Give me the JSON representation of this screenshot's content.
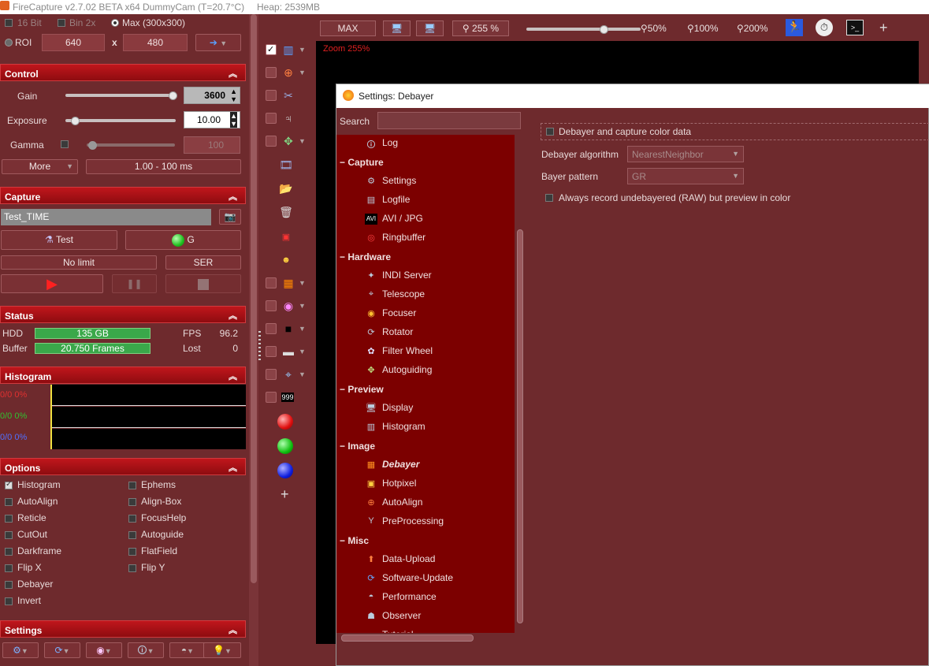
{
  "titlebar": {
    "app": "FireCapture v2.7.02 BETA x64",
    "camera": "DummyCam (T=20.7°C)",
    "heap": "Heap: 2539MB"
  },
  "top_options": {
    "bit16": "16 Bit",
    "bin2x": "Bin 2x",
    "max": "Max (300x300)",
    "roi": "ROI",
    "roi_w": "640",
    "x": "x",
    "roi_h": "480"
  },
  "control": {
    "title": "Control",
    "gain_label": "Gain",
    "gain_value": "3600",
    "gain_level": 0.98,
    "exposure_label": "Exposure",
    "exposure_value": "10.00",
    "exposure_level": 0.05,
    "gamma_label": "Gamma",
    "gamma_value": "100",
    "gamma_level": 0.0,
    "more_label": "More",
    "range_label": "1.00 - 100 ms"
  },
  "capture": {
    "title": "Capture",
    "filename": "Test_TIME",
    "test_label": "Test",
    "g_label": "G",
    "limit_label": "No limit",
    "format_label": "SER"
  },
  "status": {
    "title": "Status",
    "hdd_label": "HDD",
    "hdd_value": "135 GB",
    "fps_label": "FPS",
    "fps_value": "96.2",
    "buffer_label": "Buffer",
    "buffer_value": "20.750 Frames",
    "lost_label": "Lost",
    "lost_value": "0"
  },
  "histogram": {
    "title": "Histogram",
    "rows": [
      {
        "text": "0/0 0%",
        "color": "#e03030"
      },
      {
        "text": "0/0 0%",
        "color": "#30c030"
      },
      {
        "text": "0/0 0%",
        "color": "#5070ff"
      }
    ]
  },
  "options": {
    "title": "Options",
    "left": [
      {
        "label": "Histogram",
        "checked": true
      },
      {
        "label": "AutoAlign",
        "checked": false
      },
      {
        "label": "Reticle",
        "checked": false
      },
      {
        "label": "CutOut",
        "checked": false
      },
      {
        "label": "Darkframe",
        "checked": false
      },
      {
        "label": "Flip X",
        "checked": false
      },
      {
        "label": "Debayer",
        "checked": false
      },
      {
        "label": "Invert",
        "checked": false
      }
    ],
    "right": [
      {
        "label": "Ephems",
        "checked": false
      },
      {
        "label": "Align-Box",
        "checked": false
      },
      {
        "label": "FocusHelp",
        "checked": false
      },
      {
        "label": "Autoguide",
        "checked": false
      },
      {
        "label": "FlatField",
        "checked": false
      },
      {
        "label": "Flip Y",
        "checked": false
      }
    ]
  },
  "settings_section": {
    "title": "Settings"
  },
  "toolbar": {
    "max_label": "MAX",
    "zoom_value": "255 %",
    "z50": "50%",
    "z100": "100%",
    "z200": "200%",
    "plus": "+"
  },
  "preview": {
    "zoom_text": "Zoom 255%"
  },
  "icon_column": {
    "plus": "+"
  },
  "dialog": {
    "title": "Settings: Debayer",
    "search_label": "Search",
    "tree": [
      {
        "type": "item",
        "label": "Log",
        "icon": "info-icon"
      },
      {
        "type": "cat",
        "label": "Capture"
      },
      {
        "type": "item",
        "label": "Settings",
        "icon": "settings-icon"
      },
      {
        "type": "item",
        "label": "Logfile",
        "icon": "logfile-icon"
      },
      {
        "type": "item",
        "label": "AVI / JPG",
        "icon": "avi-icon"
      },
      {
        "type": "item",
        "label": "Ringbuffer",
        "icon": "ringbuffer-icon"
      },
      {
        "type": "cat",
        "label": "Hardware"
      },
      {
        "type": "item",
        "label": "INDI Server",
        "icon": "indi-icon"
      },
      {
        "type": "item",
        "label": "Telescope",
        "icon": "telescope-icon"
      },
      {
        "type": "item",
        "label": "Focuser",
        "icon": "focuser-icon"
      },
      {
        "type": "item",
        "label": "Rotator",
        "icon": "rotator-icon"
      },
      {
        "type": "item",
        "label": "Filter Wheel",
        "icon": "filterwheel-icon"
      },
      {
        "type": "item",
        "label": "Autoguiding",
        "icon": "autoguiding-icon"
      },
      {
        "type": "cat",
        "label": "Preview"
      },
      {
        "type": "item",
        "label": "Display",
        "icon": "display-icon"
      },
      {
        "type": "item",
        "label": "Histogram",
        "icon": "histogram-icon"
      },
      {
        "type": "cat",
        "label": "Image"
      },
      {
        "type": "item",
        "label": "Debayer",
        "icon": "debayer-icon",
        "selected": true
      },
      {
        "type": "item",
        "label": "Hotpixel",
        "icon": "hotpixel-icon"
      },
      {
        "type": "item",
        "label": "AutoAlign",
        "icon": "autoalign-icon"
      },
      {
        "type": "item",
        "label": "PreProcessing",
        "icon": "preprocessing-icon"
      },
      {
        "type": "cat",
        "label": "Misc"
      },
      {
        "type": "item",
        "label": "Data-Upload",
        "icon": "upload-icon"
      },
      {
        "type": "item",
        "label": "Software-Update",
        "icon": "update-icon"
      },
      {
        "type": "item",
        "label": "Performance",
        "icon": "performance-icon"
      },
      {
        "type": "item",
        "label": "Observer",
        "icon": "observer-icon"
      },
      {
        "type": "item",
        "label": "Tutorial",
        "icon": "tutorial-icon"
      }
    ],
    "debayer_check": "Debayer and capture color data",
    "algorithm_label": "Debayer algorithm",
    "algorithm_value": "NearestNeighbor",
    "pattern_label": "Bayer pattern",
    "pattern_value": "GR",
    "raw_check": "Always record undebayered (RAW) but preview in color"
  }
}
